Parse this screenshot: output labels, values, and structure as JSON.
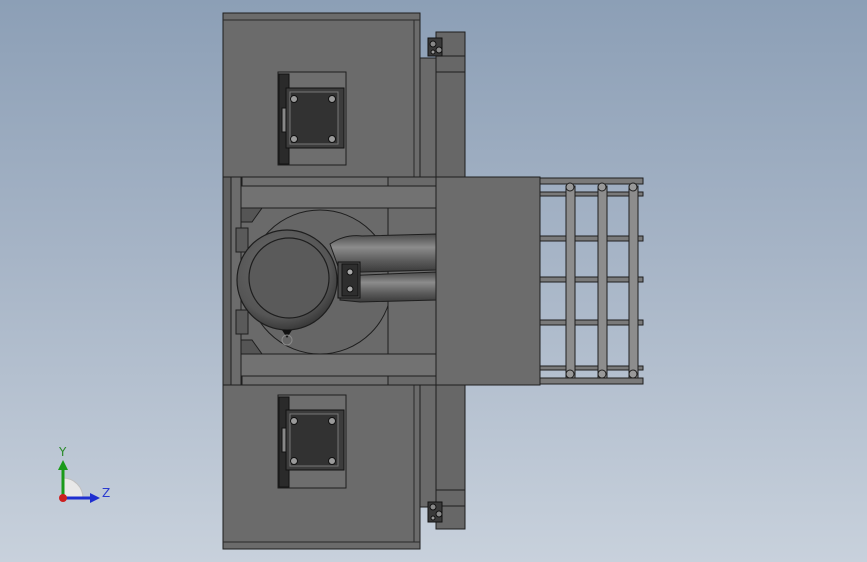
{
  "viewport": {
    "background_top": "#8c9fb6",
    "background_bottom": "#c8d1dc"
  },
  "model": {
    "body_color": "#666666",
    "dark_color": "#3a3a3a",
    "edge_color": "#1e1e1e",
    "motor_color": "#5b5b5b",
    "rail_color": "#8a8a8a"
  },
  "triad": {
    "y_label": "Y",
    "z_label": "Z",
    "y_color": "#1a9a1a",
    "z_color": "#1f2fd0",
    "x_color": "#cc1f1f"
  }
}
